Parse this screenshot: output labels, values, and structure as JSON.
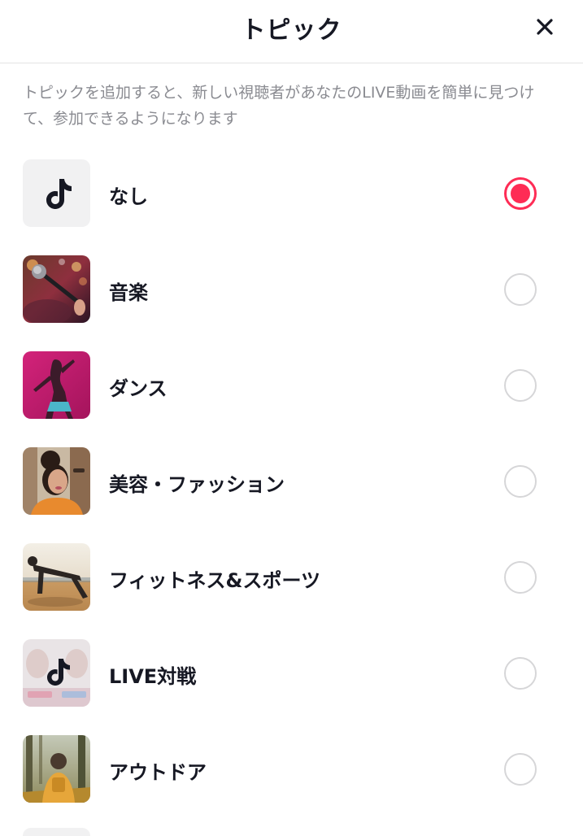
{
  "header": {
    "title": "トピック",
    "close_icon": "close-icon"
  },
  "description": "トピックを追加すると、新しい視聴者があなたのLIVE動画を簡単に見つけて、参加できるようになります",
  "accent_color": "#fe2c55",
  "topics": [
    {
      "label": "なし",
      "icon": "tiktok-logo-icon",
      "selected": true
    },
    {
      "label": "音楽",
      "icon": "music-thumbnail",
      "selected": false
    },
    {
      "label": "ダンス",
      "icon": "dance-thumbnail",
      "selected": false
    },
    {
      "label": "美容・ファッション",
      "icon": "beauty-fashion-thumbnail",
      "selected": false
    },
    {
      "label": "フィットネス&スポーツ",
      "icon": "fitness-sports-thumbnail",
      "selected": false
    },
    {
      "label": "LIVE対戦",
      "icon": "live-battle-thumbnail",
      "selected": false
    },
    {
      "label": "アウトドア",
      "icon": "outdoor-thumbnail",
      "selected": false
    }
  ]
}
